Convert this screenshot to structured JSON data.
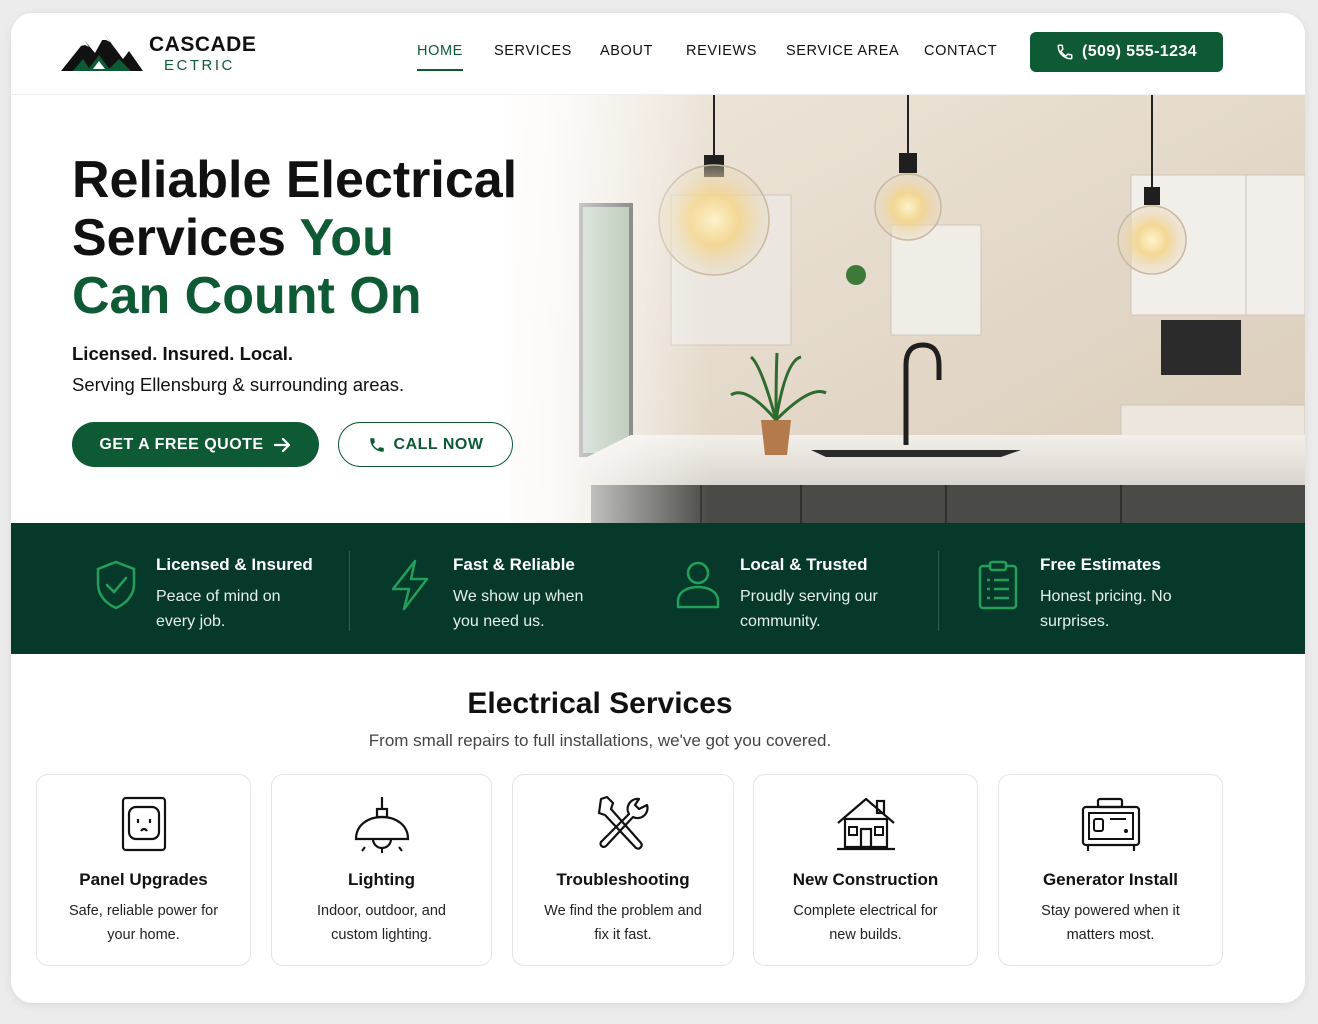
{
  "brand": {
    "name": "CASCADE",
    "sub": "ECTRIC"
  },
  "nav": [
    {
      "label": "HOME",
      "active": true
    },
    {
      "label": "SERVICES"
    },
    {
      "label": "ABOUT"
    },
    {
      "label": "REVIEWS"
    },
    {
      "label": "SERVICE AREA"
    },
    {
      "label": "CONTACT"
    }
  ],
  "header_phone": "(509) 555-1234",
  "hero": {
    "title_line1": "Reliable Electrical",
    "title_line2a": "Services ",
    "title_line2b": "You",
    "title_line3": "Can Count On",
    "subtitle_bold": "Licensed. Insured. Local.",
    "subtitle": "Serving Ellensburg & surrounding areas.",
    "quote_button": "GET A FREE QUOTE",
    "call_button": "CALL NOW"
  },
  "features": [
    {
      "icon": "shield-check-icon",
      "title": "Licensed & Insured",
      "desc": "Peace of mind on every job."
    },
    {
      "icon": "lightning-bolt-icon",
      "title": "Fast & Reliable",
      "desc": "We show up when you need us."
    },
    {
      "icon": "person-icon",
      "title": "Local & Trusted",
      "desc": "Proudly serving our community."
    },
    {
      "icon": "clipboard-list-icon",
      "title": "Free Estimates",
      "desc": "Honest pricing. No surprises."
    }
  ],
  "services": {
    "title": "Electrical Services",
    "subtitle": "From small repairs to full installations, we've got you covered.",
    "items": [
      {
        "icon": "outlet-panel-icon",
        "title": "Panel Upgrades",
        "desc": "Safe, reliable power for your home."
      },
      {
        "icon": "pendant-lamp-icon",
        "title": "Lighting",
        "desc": "Indoor, outdoor, and custom lighting."
      },
      {
        "icon": "wrench-screwdriver-icon",
        "title": "Troubleshooting",
        "desc": "We find the problem and fix it fast."
      },
      {
        "icon": "house-icon",
        "title": "New Construction",
        "desc": "Complete electrical for new builds."
      },
      {
        "icon": "generator-icon",
        "title": "Generator Install",
        "desc": "Stay powered when it matters most."
      }
    ]
  },
  "colors": {
    "brand_green": "#0d5a34",
    "band_bg": "#06392a",
    "accent_green": "#22a05a"
  }
}
